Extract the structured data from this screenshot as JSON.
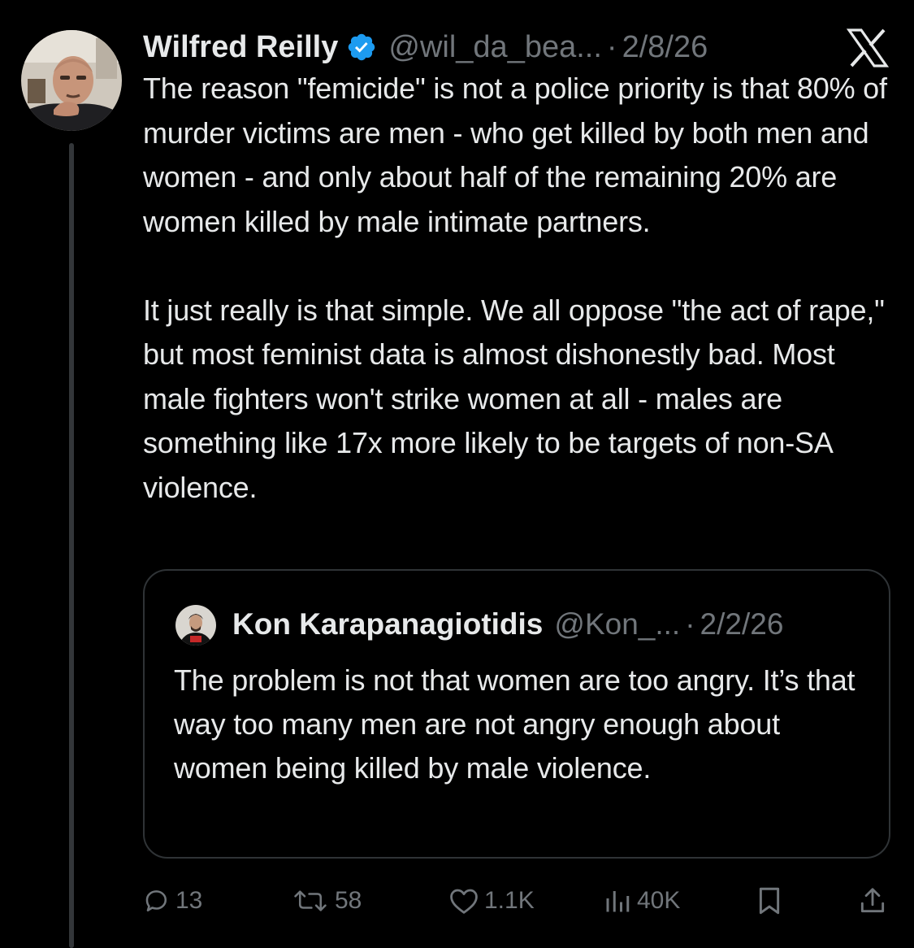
{
  "tweet": {
    "author_name": "Wilfred Reilly",
    "handle": "@wil_da_bea...",
    "separator": "·",
    "date": "2/8/26",
    "text": "The reason \"femicide\" is not a police priority is that 80% of murder victims are men - who get killed by both men and women - and only about half of the remaining 20% are women killed by male intimate partners.\n\nIt just really is that simple. We all oppose \"the act of rape,\" but most feminist data is almost dishonestly bad. Most male fighters won't strike women at all - males are something like 17x more likely to be targets of non-SA violence.",
    "verified_icon": "verified-badge-icon",
    "platform_icon": "x-logo-icon"
  },
  "quote": {
    "author_name": "Kon Karapanagiotidis",
    "handle": "@Kon_...",
    "separator": "·",
    "date": "2/2/26",
    "text": "The problem is not that women are too angry. It’s that way too many men are not angry enough about women being killed by male violence."
  },
  "actions": {
    "replies": "13",
    "reposts": "58",
    "likes": "1.1K",
    "views": "40K"
  },
  "colors": {
    "background": "#000000",
    "text_primary": "#e7e9ea",
    "text_secondary": "#71767b",
    "verified_blue": "#1d9bf0",
    "border": "#2f3336"
  }
}
